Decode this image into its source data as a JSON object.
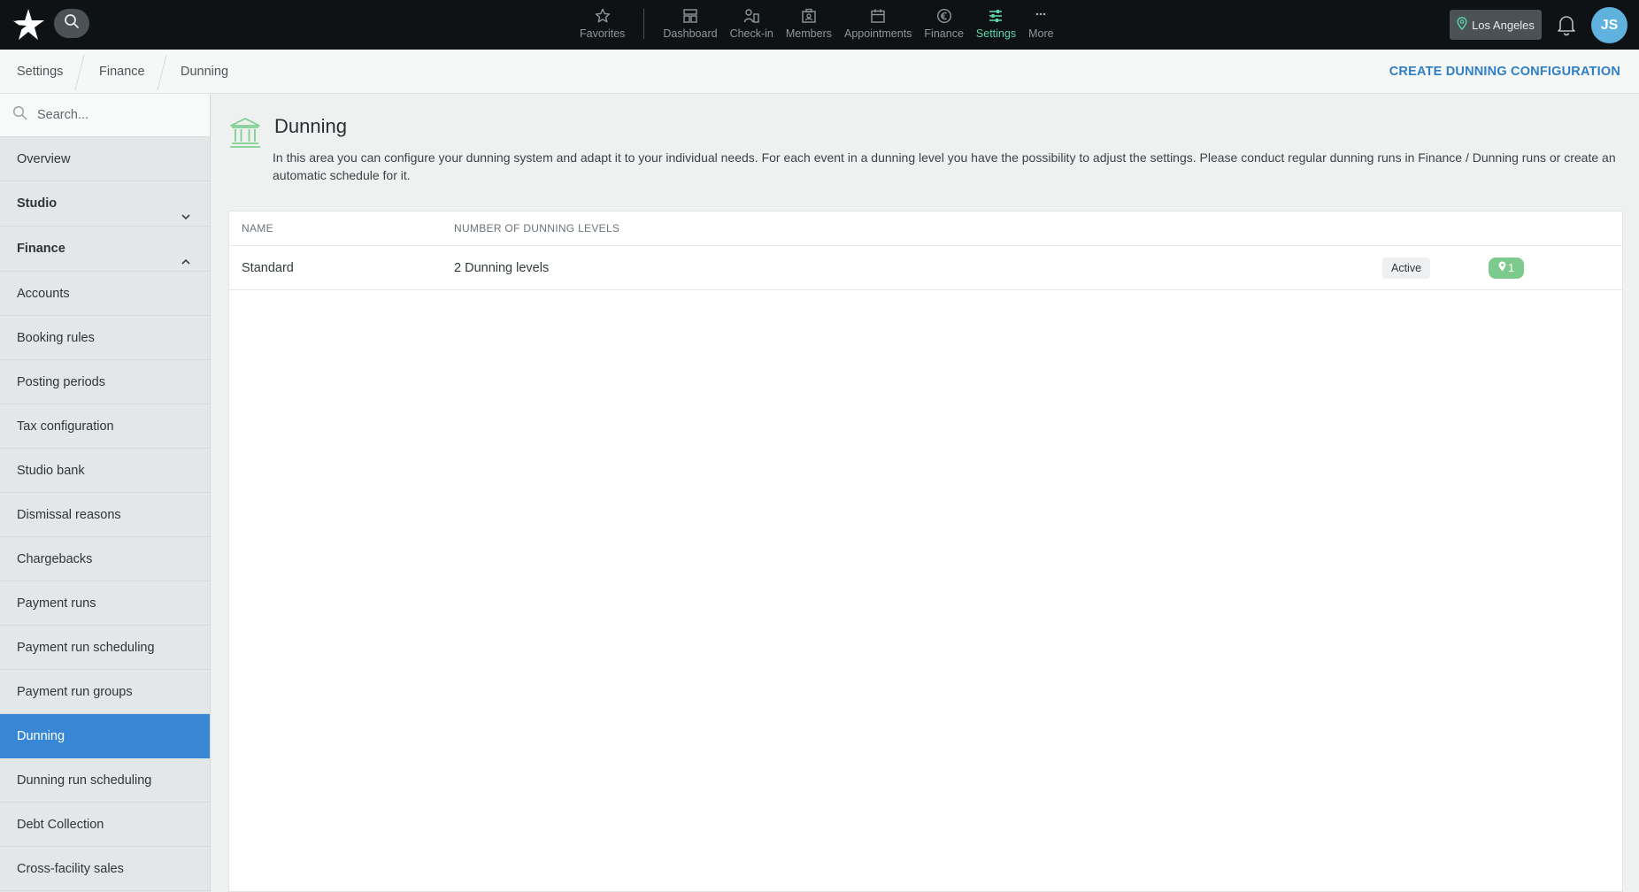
{
  "topbar": {
    "location": "Los Angeles",
    "avatar_initials": "JS",
    "nav": [
      {
        "label": "Favorites",
        "icon": "star-icon"
      },
      {
        "label": "Dashboard",
        "icon": "dashboard-icon"
      },
      {
        "label": "Check-in",
        "icon": "check-in-icon"
      },
      {
        "label": "Members",
        "icon": "members-icon"
      },
      {
        "label": "Appointments",
        "icon": "calendar-icon"
      },
      {
        "label": "Finance",
        "icon": "euro-icon"
      },
      {
        "label": "Settings",
        "icon": "sliders-icon",
        "active": true
      },
      {
        "label": "More",
        "icon": "ellipsis-icon"
      }
    ],
    "colors": {
      "background": "#0f1215",
      "active": "#5ed4a8"
    }
  },
  "breadcrumb": {
    "items": [
      "Settings",
      "Finance",
      "Dunning"
    ],
    "action_label": "CREATE DUNNING CONFIGURATION"
  },
  "sidebar": {
    "search_placeholder": "Search...",
    "items": [
      {
        "label": "Overview"
      },
      {
        "label": "Studio",
        "section": true,
        "expanded": false
      },
      {
        "label": "Finance",
        "section": true,
        "expanded": true
      },
      {
        "label": "Accounts"
      },
      {
        "label": "Booking rules"
      },
      {
        "label": "Posting periods"
      },
      {
        "label": "Tax configuration"
      },
      {
        "label": "Studio bank"
      },
      {
        "label": "Dismissal reasons"
      },
      {
        "label": "Chargebacks"
      },
      {
        "label": "Payment runs"
      },
      {
        "label": "Payment run scheduling"
      },
      {
        "label": "Payment run groups"
      },
      {
        "label": "Dunning",
        "active": true
      },
      {
        "label": "Dunning run scheduling"
      },
      {
        "label": "Debt Collection"
      },
      {
        "label": "Cross-facility sales"
      }
    ],
    "colors": {
      "active": "#3787d4"
    }
  },
  "main": {
    "title": "Dunning",
    "description": "In this area you can configure your dunning system and adapt it to your individual needs. For each event in a dunning level you have the possibility to adjust the settings. Please conduct regular dunning runs in Finance / Dunning runs or create an automatic schedule for it.",
    "table": {
      "columns": [
        "NAME",
        "NUMBER OF DUNNING LEVELS"
      ],
      "rows": [
        {
          "name": "Standard",
          "levels": "2 Dunning levels",
          "status": "Active",
          "locations_count": "1"
        }
      ]
    }
  }
}
